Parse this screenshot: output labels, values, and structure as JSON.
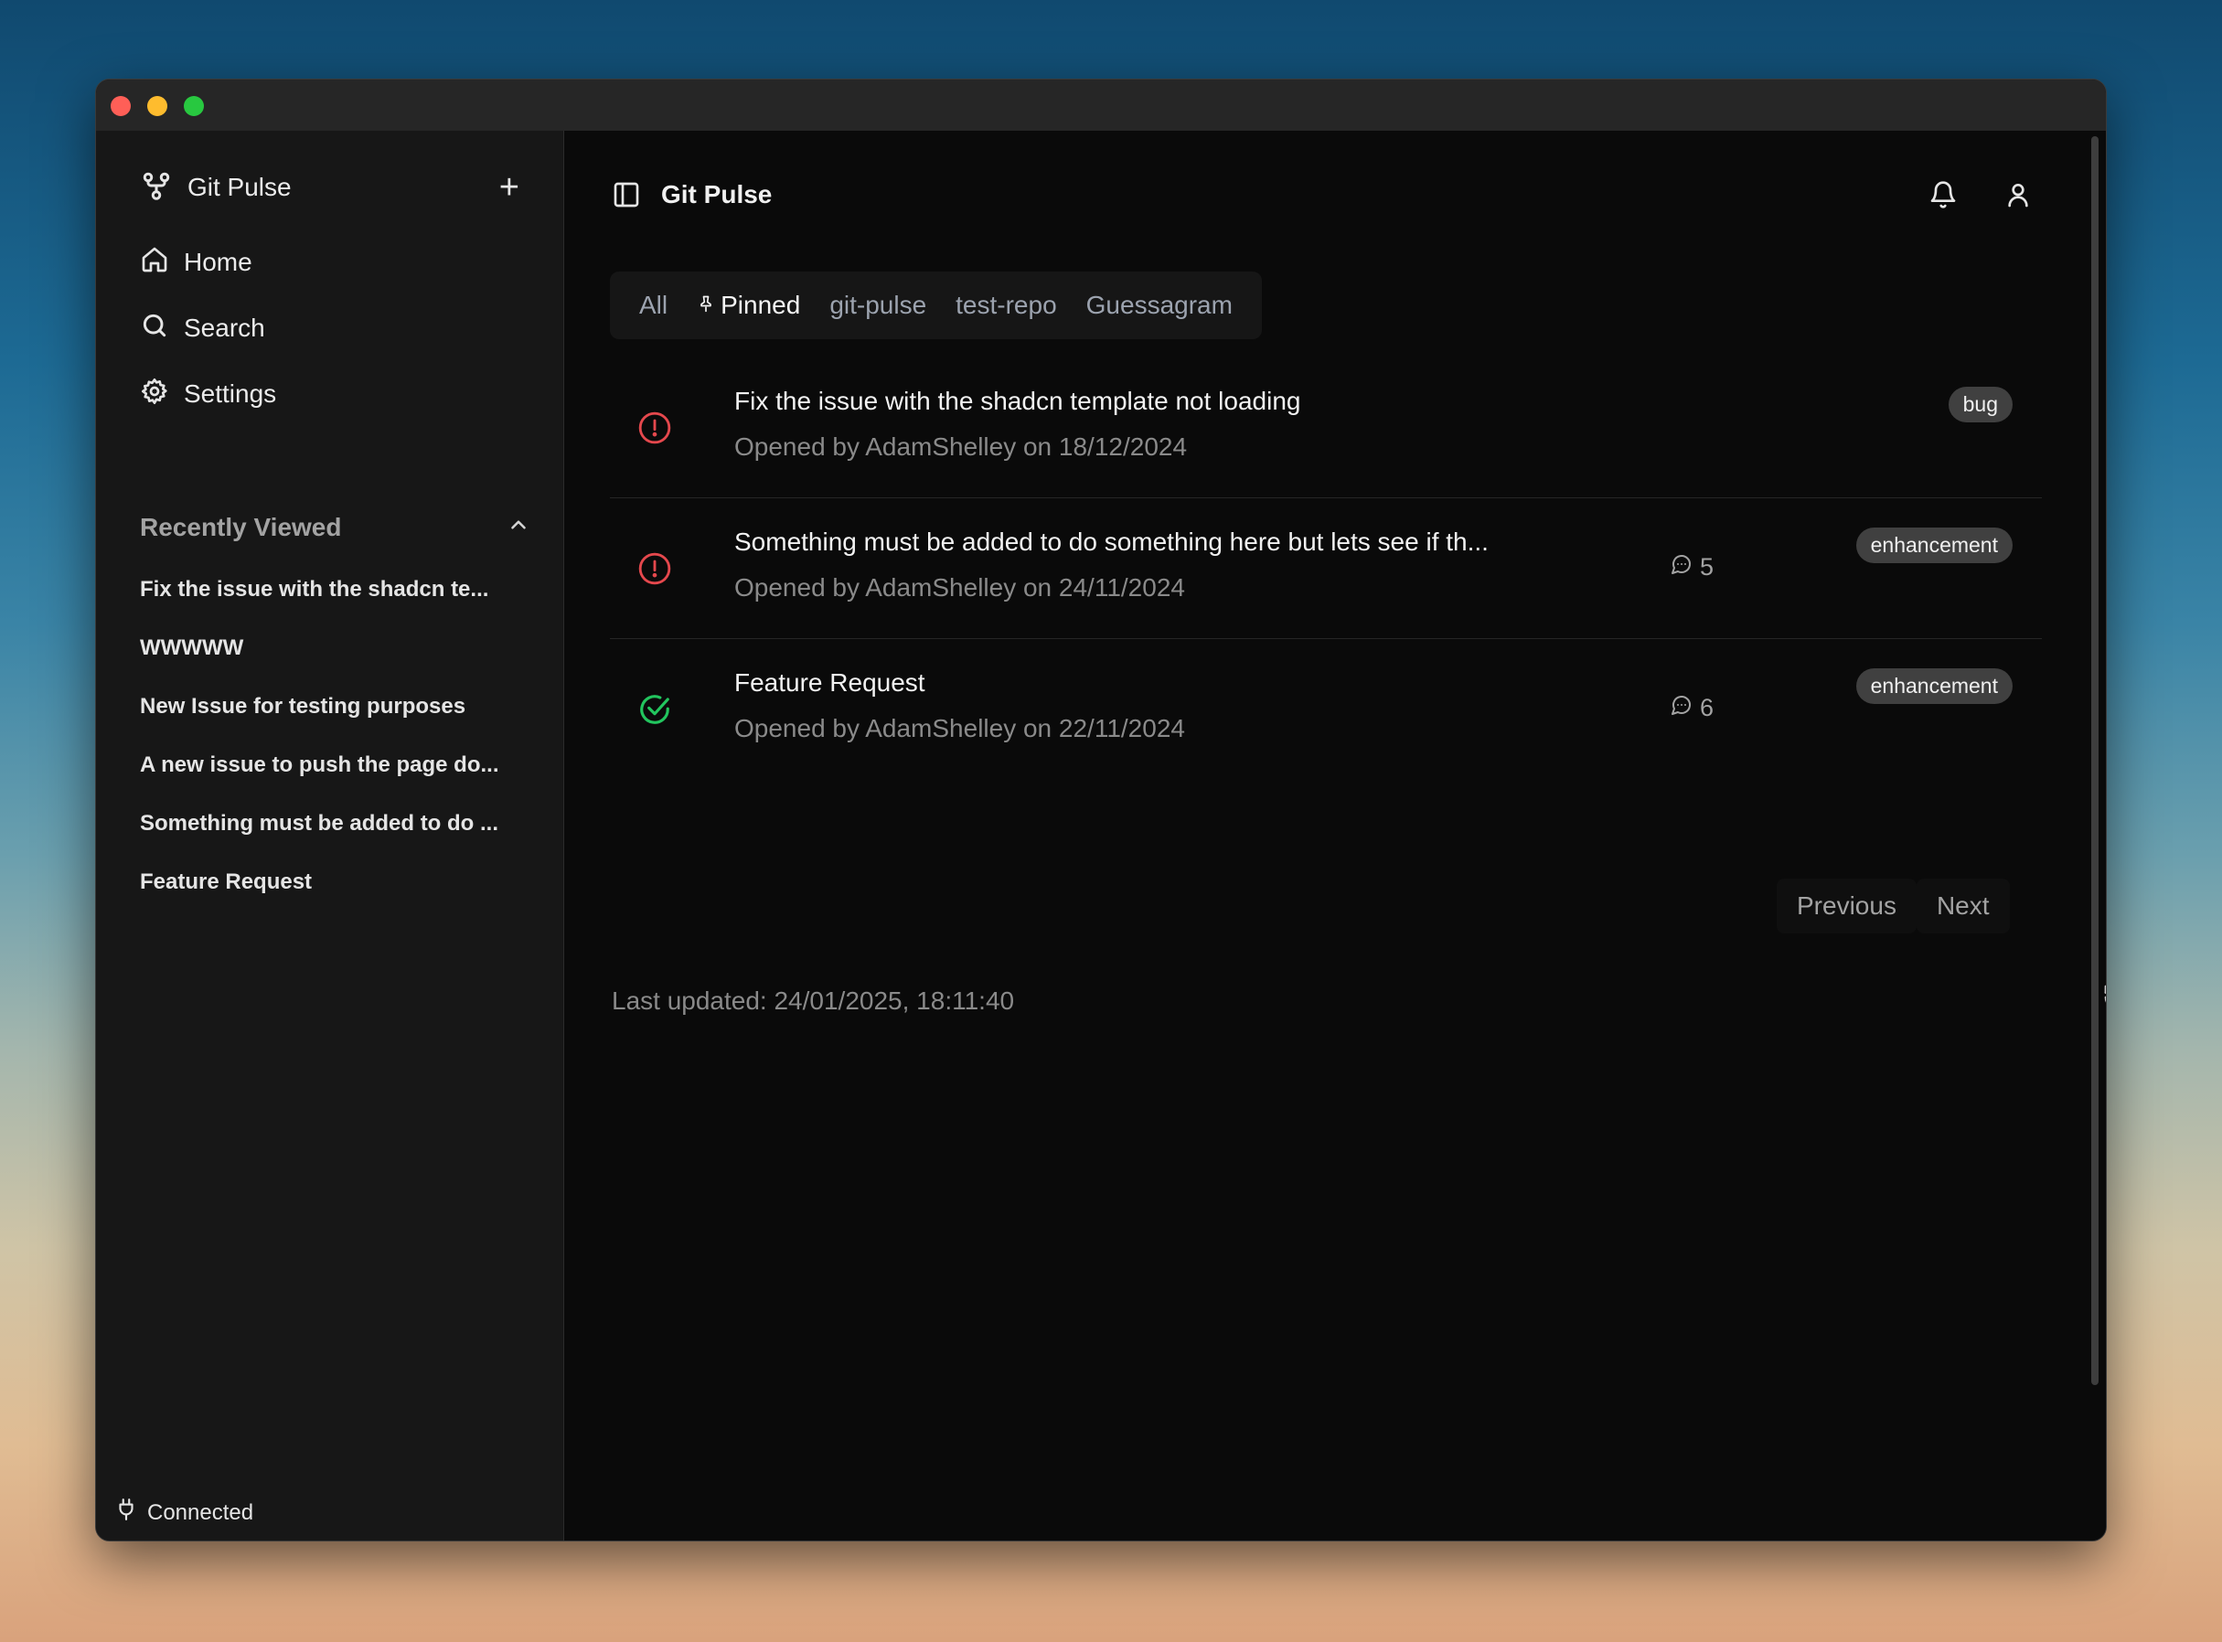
{
  "sidebar": {
    "app_title": "Git Pulse",
    "nav": [
      {
        "label": "Home"
      },
      {
        "label": "Search"
      },
      {
        "label": "Settings"
      }
    ],
    "recent_heading": "Recently Viewed",
    "recent": [
      "Fix the issue with the shadcn te...",
      "WWWWW",
      "New Issue for testing purposes",
      "A new issue to push the page do...",
      "Something must be added to do ...",
      "Feature Request"
    ],
    "connection_status": "Connected"
  },
  "header": {
    "title": "Git Pulse"
  },
  "tabs": [
    {
      "label": "All"
    },
    {
      "label": "Pinned"
    },
    {
      "label": "git-pulse"
    },
    {
      "label": "test-repo"
    },
    {
      "label": "Guessagram"
    }
  ],
  "issues": [
    {
      "title": "Fix the issue with the shadcn template not loading",
      "meta": "Opened by AdamShelley on 18/12/2024",
      "comments": "",
      "label": "bug",
      "state": "open"
    },
    {
      "title": "Something must be added to do something here but lets see if th...",
      "meta": "Opened by AdamShelley on 24/11/2024",
      "comments": "5",
      "label": "enhancement",
      "state": "open"
    },
    {
      "title": "Feature Request",
      "meta": "Opened by AdamShelley on 22/11/2024",
      "comments": "6",
      "label": "enhancement",
      "state": "closed"
    }
  ],
  "pagination": {
    "previous": "Previous",
    "next": "Next"
  },
  "last_updated": "Last updated: 24/01/2025, 18:11:40",
  "colors": {
    "open": "#e5484d",
    "closed": "#22c55e",
    "badge": "#404040"
  }
}
